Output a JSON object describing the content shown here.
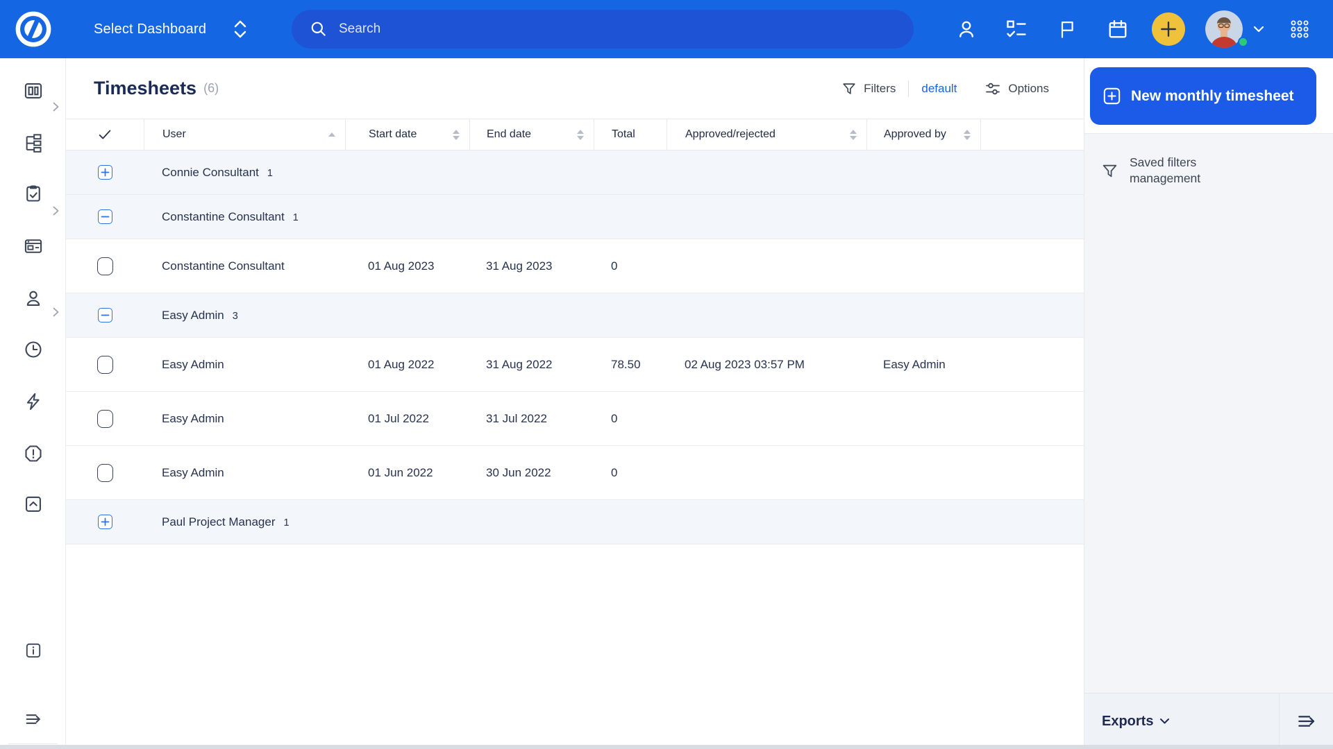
{
  "topbar": {
    "dashboard_selector_label": "Select Dashboard",
    "search_placeholder": "Search",
    "colors": {
      "bar": "#1566E3",
      "search_pill": "#1E53D6",
      "plus_button": "#F0C23B",
      "online_dot": "#2BCB77"
    }
  },
  "sidebar": {
    "items": [
      {
        "icon": "dashboard-icon",
        "has_chevron": true
      },
      {
        "icon": "project-tree-icon",
        "has_chevron": true
      },
      {
        "icon": "tasks-clipboard-icon",
        "has_chevron": true
      },
      {
        "icon": "cards-icon",
        "has_chevron": false
      },
      {
        "icon": "user-icon",
        "has_chevron": false
      },
      {
        "icon": "time-icon",
        "has_chevron": false
      },
      {
        "icon": "quick-actions-icon",
        "has_chevron": false
      },
      {
        "icon": "alerts-icon",
        "has_chevron": false
      },
      {
        "icon": "upgrade-icon",
        "has_chevron": false
      },
      {
        "icon": "info-icon",
        "has_chevron": false
      },
      {
        "icon": "collapse-sidebar-icon",
        "has_chevron": false
      }
    ]
  },
  "page": {
    "title": "Timesheets",
    "count": "(6)"
  },
  "toolbar": {
    "filters_label": "Filters",
    "active_filter": "default",
    "options_label": "Options"
  },
  "table": {
    "columns": {
      "user": "User",
      "start": "Start date",
      "end": "End date",
      "total": "Total",
      "approved_rejected": "Approved/rejected",
      "approved_by": "Approved by"
    },
    "sort": {
      "column": "User",
      "direction": "asc"
    },
    "rows": [
      {
        "type": "group",
        "expanded": false,
        "name": "Connie Consultant",
        "count": "1"
      },
      {
        "type": "group",
        "expanded": true,
        "name": "Constantine Consultant",
        "count": "1"
      },
      {
        "type": "data",
        "user": "Constantine Consultant",
        "start": "01 Aug 2023",
        "end": "31 Aug 2023",
        "total": "0",
        "approved_rejected": "",
        "approved_by": ""
      },
      {
        "type": "group",
        "expanded": true,
        "name": "Easy Admin",
        "count": "3"
      },
      {
        "type": "data",
        "user": "Easy Admin",
        "start": "01 Aug 2022",
        "end": "31 Aug 2022",
        "total": "78.50",
        "approved_rejected": "02 Aug 2023 03:57 PM",
        "approved_by": "Easy Admin"
      },
      {
        "type": "data",
        "user": "Easy Admin",
        "start": "01 Jul 2022",
        "end": "31 Jul 2022",
        "total": "0",
        "approved_rejected": "",
        "approved_by": ""
      },
      {
        "type": "data",
        "user": "Easy Admin",
        "start": "01 Jun 2022",
        "end": "30 Jun 2022",
        "total": "0",
        "approved_rejected": "",
        "approved_by": ""
      },
      {
        "type": "group",
        "expanded": false,
        "name": "Paul Project Manager",
        "count": "1"
      }
    ]
  },
  "panel": {
    "new_button_label": "New monthly timesheet",
    "saved_filters_label": "Saved filters management",
    "exports_label": "Exports",
    "accent_color": "#1B5BE8"
  }
}
